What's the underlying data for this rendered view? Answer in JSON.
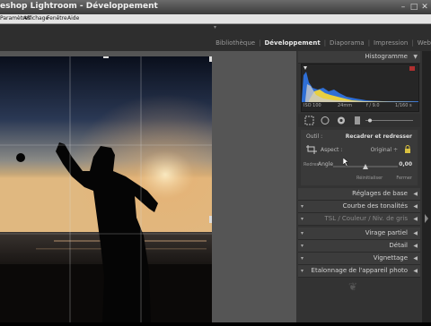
{
  "window": {
    "title": "eshop Lightroom - Développement",
    "minimize": "–",
    "maximize": "□",
    "close": "✕"
  },
  "menu": [
    "Paramètres",
    "Affichage",
    "Fenêtre",
    "Aide"
  ],
  "modules": {
    "items": [
      "Bibliothèque",
      "Développement",
      "Diaporama",
      "Impression",
      "Web"
    ],
    "active": 1
  },
  "histogram": {
    "title": "Histogramme",
    "iso": "ISO 100",
    "focal": "24mm",
    "aperture": "f / 9.0",
    "shutter": "1/160 s"
  },
  "crop_panel": {
    "tool_label": "Outil :",
    "title": "Recadrer et redresser",
    "aspect_label": "Aspect :",
    "aspect_value": "Original ÷",
    "straighten_label": "Redres",
    "angle_label": "Angle",
    "angle_value": "0,00",
    "reset": "Réinitialiser",
    "close": "Fermer"
  },
  "panels": [
    {
      "label": "Réglages de base"
    },
    {
      "label": "Courbe des tonalités"
    },
    {
      "label": "TSL / Couleur / Niv. de gris"
    },
    {
      "label": "Virage partiel"
    },
    {
      "label": "Détail"
    },
    {
      "label": "Vignettage"
    },
    {
      "label": "Etalonnage de l'appareil photo"
    }
  ],
  "ornament": "❦",
  "colors": {
    "panel_bg": "#333333",
    "header_bg": "#3c3c3c",
    "histo_blue": "#2f6fd6",
    "histo_yellow": "#e8d040"
  }
}
